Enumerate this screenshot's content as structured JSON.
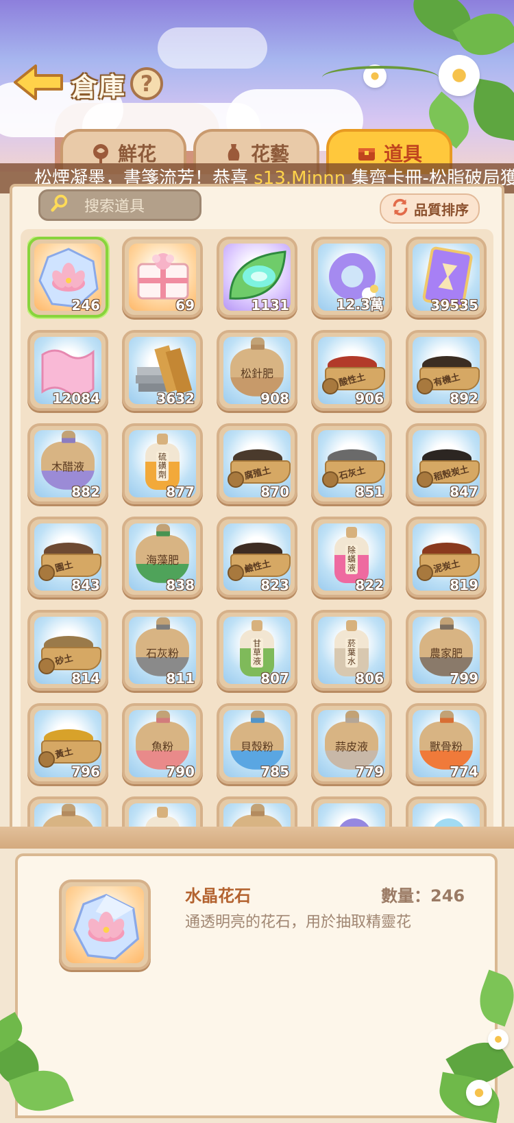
{
  "header": {
    "title": "倉庫",
    "help_label": "?"
  },
  "tabs": [
    {
      "label": "鮮花",
      "icon": "rose-icon",
      "active": false
    },
    {
      "label": "花藝",
      "icon": "vase-icon",
      "active": false
    },
    {
      "label": "道具",
      "icon": "chest-icon",
      "active": true
    }
  ],
  "marquee": {
    "prefix": "松煙凝墨，書箋流芳！恭喜 ",
    "player": "s13.Minnn",
    "suffix": " 集齊卡冊-松脂破局獲得"
  },
  "search": {
    "placeholder": "搜索道具"
  },
  "sort": {
    "label": "品質排序"
  },
  "items": [
    {
      "name": "水晶花石",
      "count": "246",
      "icon": "crystal-lotus-icon",
      "selected": true
    },
    {
      "name": "禮物包",
      "count": "69",
      "icon": "gift-pack-icon"
    },
    {
      "name": "葉片",
      "count": "1131",
      "icon": "leaf-portal-icon"
    },
    {
      "name": "花環",
      "count": "12.3萬",
      "icon": "purple-ring-icon"
    },
    {
      "name": "沙漏卡",
      "count": "39535",
      "icon": "hourglass-card-icon"
    },
    {
      "name": "紙卷",
      "count": "12084",
      "icon": "pink-scroll-icon"
    },
    {
      "name": "木材石材",
      "count": "3632",
      "icon": "wood-stone-icon"
    },
    {
      "name": "松針肥",
      "count": "908",
      "icon": "sack-icon",
      "label": "松針肥",
      "color": "#c79a6a"
    },
    {
      "name": "酸性土",
      "count": "906",
      "icon": "wheelbarrow-icon",
      "label": "酸性土",
      "color": "#b23a2a"
    },
    {
      "name": "有機土",
      "count": "892",
      "icon": "wheelbarrow-icon",
      "label": "有機土",
      "color": "#3b2d22"
    },
    {
      "name": "木醋液",
      "count": "882",
      "icon": "sack-icon",
      "label": "木醋液",
      "color": "#9b8bd6"
    },
    {
      "name": "硫磺劑",
      "count": "877",
      "icon": "bottle-icon",
      "label": "硫磺劑",
      "color": "#f2a93a"
    },
    {
      "name": "腐殖土",
      "count": "870",
      "icon": "wheelbarrow-icon",
      "label": "腐殖土",
      "color": "#4a3a2c"
    },
    {
      "name": "石灰土",
      "count": "851",
      "icon": "wheelbarrow-icon",
      "label": "石灰土",
      "color": "#6a6a6a"
    },
    {
      "name": "稻殼炭土",
      "count": "847",
      "icon": "wheelbarrow-icon",
      "label": "稻殼炭土",
      "color": "#2c2622"
    },
    {
      "name": "園土",
      "count": "843",
      "icon": "wheelbarrow-icon",
      "label": "園土",
      "color": "#6e4a32"
    },
    {
      "name": "海藻肥",
      "count": "838",
      "icon": "sack-icon",
      "label": "海藻肥",
      "color": "#4fa35a"
    },
    {
      "name": "鹼性土",
      "count": "823",
      "icon": "wheelbarrow-icon",
      "label": "鹼性土",
      "color": "#3e2c22"
    },
    {
      "name": "除蟎液",
      "count": "822",
      "icon": "bottle-icon",
      "label": "除蟎液",
      "color": "#ee6aa0"
    },
    {
      "name": "泥炭土",
      "count": "819",
      "icon": "wheelbarrow-icon",
      "label": "泥炭土",
      "color": "#8a3a1e"
    },
    {
      "name": "砂土",
      "count": "814",
      "icon": "wheelbarrow-icon",
      "label": "砂土",
      "color": "#9a7a4a"
    },
    {
      "name": "石灰粉",
      "count": "811",
      "icon": "sack-icon",
      "label": "石灰粉",
      "color": "#8a8a8a"
    },
    {
      "name": "甘草液",
      "count": "807",
      "icon": "bottle-icon",
      "label": "甘草液",
      "color": "#7fba5a"
    },
    {
      "name": "菸葉水",
      "count": "806",
      "icon": "bottle-icon",
      "label": "菸葉水",
      "color": "#d8c8b0"
    },
    {
      "name": "農家肥",
      "count": "799",
      "icon": "sack-icon",
      "label": "農家肥",
      "color": "#8a7a6a"
    },
    {
      "name": "黃土",
      "count": "796",
      "icon": "wheelbarrow-icon",
      "label": "黃土",
      "color": "#d8a22a"
    },
    {
      "name": "魚粉",
      "count": "790",
      "icon": "sack-icon",
      "label": "魚粉",
      "color": "#e98a8a"
    },
    {
      "name": "貝殼粉",
      "count": "785",
      "icon": "sack-icon",
      "label": "貝殼粉",
      "color": "#5aa6e2"
    },
    {
      "name": "蒜皮液",
      "count": "779",
      "icon": "sack-icon",
      "label": "蒜皮液",
      "color": "#c8b8a8"
    },
    {
      "name": "獸骨粉",
      "count": "774",
      "icon": "sack-icon",
      "label": "獸骨粉",
      "color": "#f07a3a"
    },
    {
      "name": "",
      "count": "",
      "icon": "sack-icon",
      "label": "",
      "color": "#c79a6a"
    },
    {
      "name": "",
      "count": "",
      "icon": "bottle-icon",
      "label": "",
      "color": "#d7b17d"
    },
    {
      "name": "",
      "count": "",
      "icon": "sack-icon",
      "label": "",
      "color": "#c79a6a"
    },
    {
      "name": "",
      "count": "",
      "icon": "orb-icon",
      "label": "",
      "color": "#7a6ad8"
    },
    {
      "name": "",
      "count": "",
      "icon": "orb-icon",
      "label": "",
      "color": "#8ad2f0"
    }
  ],
  "detail": {
    "name": "水晶花石",
    "quantity": "數量：246",
    "description": "通透明亮的花石，用於抽取精靈花"
  }
}
